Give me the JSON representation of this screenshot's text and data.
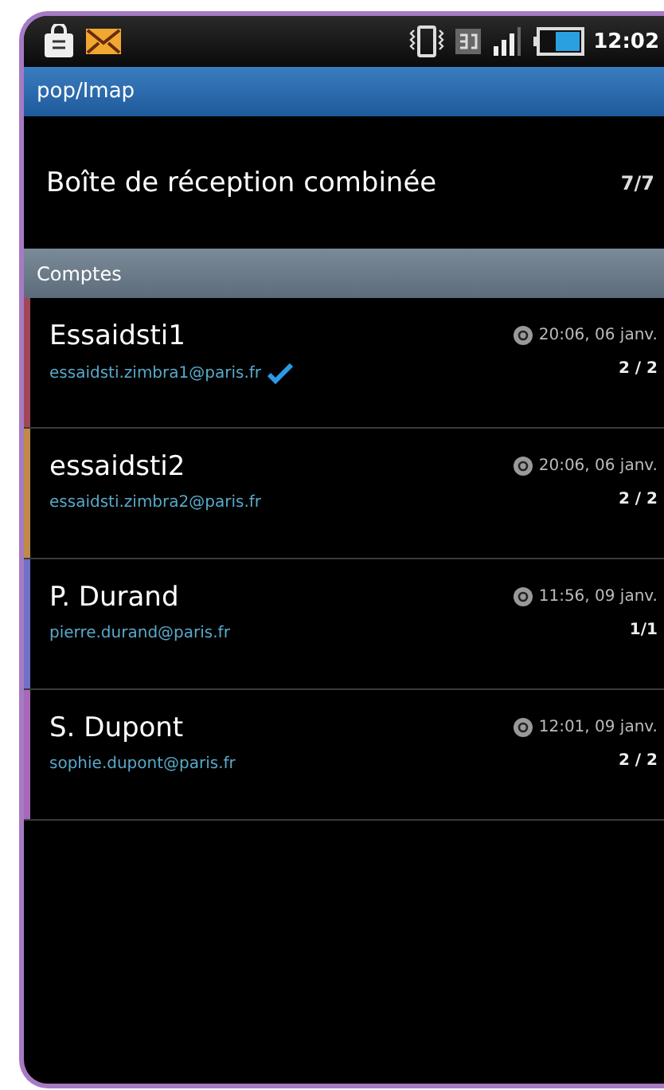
{
  "status_bar": {
    "time": "12:02"
  },
  "title_bar": {
    "title": "pop/Imap"
  },
  "combined_inbox": {
    "label": "Boîte de réception combinée",
    "count": "7/7"
  },
  "section": {
    "label": "Comptes"
  },
  "accounts": [
    {
      "name": "Essaidsti1",
      "email": "essaidsti.zimbra1@paris.fr",
      "sync_time": "20:06, 06 janv.",
      "count": "2 / 2",
      "color": "#a04858",
      "selected": true
    },
    {
      "name": "essaidsti2",
      "email": "essaidsti.zimbra2@paris.fr",
      "sync_time": "20:06, 06 janv.",
      "count": "2 / 2",
      "color": "#c08a48",
      "selected": false
    },
    {
      "name": "P. Durand",
      "email": "pierre.durand@paris.fr",
      "sync_time": "11:56, 09 janv.",
      "count": "1/1",
      "color": "#7070c8",
      "selected": false
    },
    {
      "name": "S. Dupont",
      "email": "sophie.dupont@paris.fr",
      "sync_time": "12:01, 09 janv.",
      "count": "2 / 2",
      "color": "#a868b8",
      "selected": false
    }
  ]
}
